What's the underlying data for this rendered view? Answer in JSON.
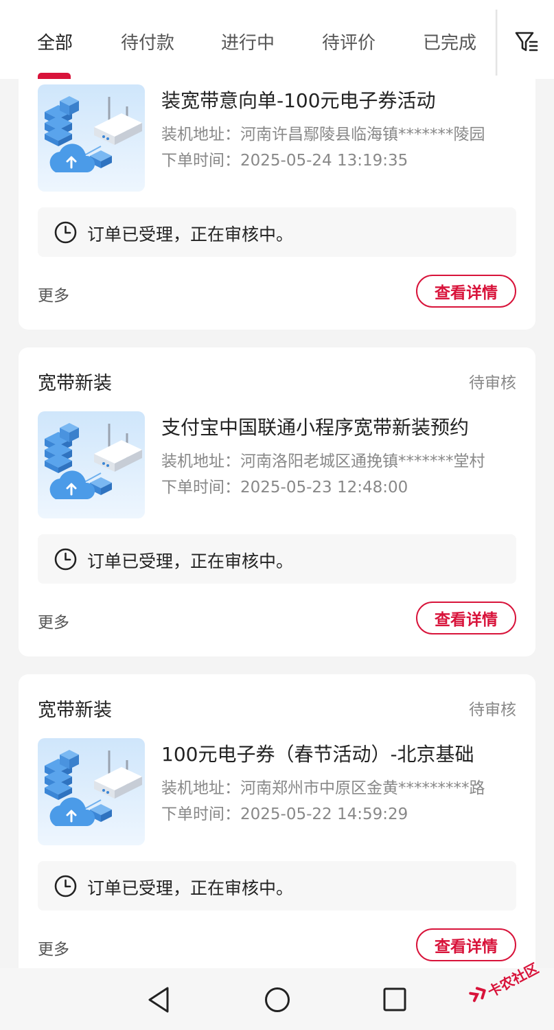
{
  "tabs": [
    "全部",
    "待付款",
    "进行中",
    "待评价",
    "已完成"
  ],
  "active_tab": "全部",
  "filter_icon": "filter-icon",
  "orders": [
    {
      "type": "",
      "status": "",
      "title": "装宽带意向单-100元电子券活动",
      "address": "装机地址：河南许昌鄢陵县临海镇*******陵园",
      "time": "下单时间：2025-05-24 13:19:35",
      "notice": "订单已受理，正在审核中。",
      "more": "更多",
      "detail_label": "查看详情"
    },
    {
      "type": "宽带新装",
      "status": "待审核",
      "title": "支付宝中国联通小程序宽带新装预约",
      "address": "装机地址：河南洛阳老城区通挽镇*******堂村",
      "time": "下单时间：2025-05-23 12:48:00",
      "notice": "订单已受理，正在审核中。",
      "more": "更多",
      "detail_label": "查看详情"
    },
    {
      "type": "宽带新装",
      "status": "待审核",
      "title": "100元电子券（春节活动）-北京基础",
      "address": "装机地址：河南郑州市中原区金黄*********路",
      "time": "下单时间：2025-05-22 14:59:29",
      "notice": "订单已受理，正在审核中。",
      "more": "更多",
      "detail_label": "查看详情"
    }
  ],
  "watermark": "卡农社区",
  "colors": {
    "accent": "#d8133a",
    "background": "#f4f4f4",
    "card": "#ffffff"
  }
}
